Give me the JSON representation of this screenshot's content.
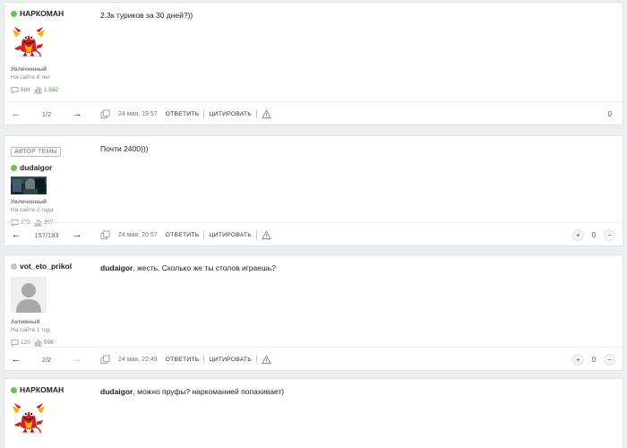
{
  "colors": {
    "online": "#6cbf5a",
    "offline": "#c4c4c4",
    "reputation": "#4aa03c"
  },
  "ui": {
    "reply_label": "ОТВЕТИТЬ",
    "quote_label": "ЦИТИРОВАТЬ",
    "plus": "+",
    "minus": "−",
    "prev_arrow": "←",
    "next_arrow": "→"
  },
  "posts": [
    {
      "author": {
        "name": "НАРКОМАН",
        "status": "online",
        "rank": "Увлеченный",
        "since": "На сайте 6 лет",
        "messages": "884",
        "reputation": "1,542",
        "avatar": "devil-mascot"
      },
      "text": "2.3к туриков за 30 дней?))",
      "page": "1/2",
      "date": "24 мая, 19:57",
      "score": "0"
    },
    {
      "author_badge": "АВТОР ТЕМЫ",
      "author": {
        "name": "dudaigor",
        "status": "online",
        "rank": "Увлеченный",
        "since": "На сайте 2 года",
        "messages": "373",
        "reputation": "307",
        "avatar": "dark-photo"
      },
      "text": "Почти 2400)))",
      "page": "157/183",
      "date": "24 мая, 20:57",
      "score": "0"
    },
    {
      "author": {
        "name": "vot_eto_prikol",
        "status": "offline",
        "rank": "Активный",
        "since": "На сайте 1 год",
        "messages": "120",
        "reputation": "598",
        "avatar": "default-silhouette"
      },
      "reply_to": "dudaigor",
      "text": ", жесть. Сколько же ты столов играешь?",
      "page": "2/2",
      "date": "24 мая, 22:49",
      "score": "0"
    },
    {
      "author": {
        "name": "НАРКОМАН",
        "status": "online",
        "avatar": "devil-mascot"
      },
      "reply_to": "dudaigor",
      "text": ", можно пруфы? наркоманией попахивает)"
    }
  ]
}
